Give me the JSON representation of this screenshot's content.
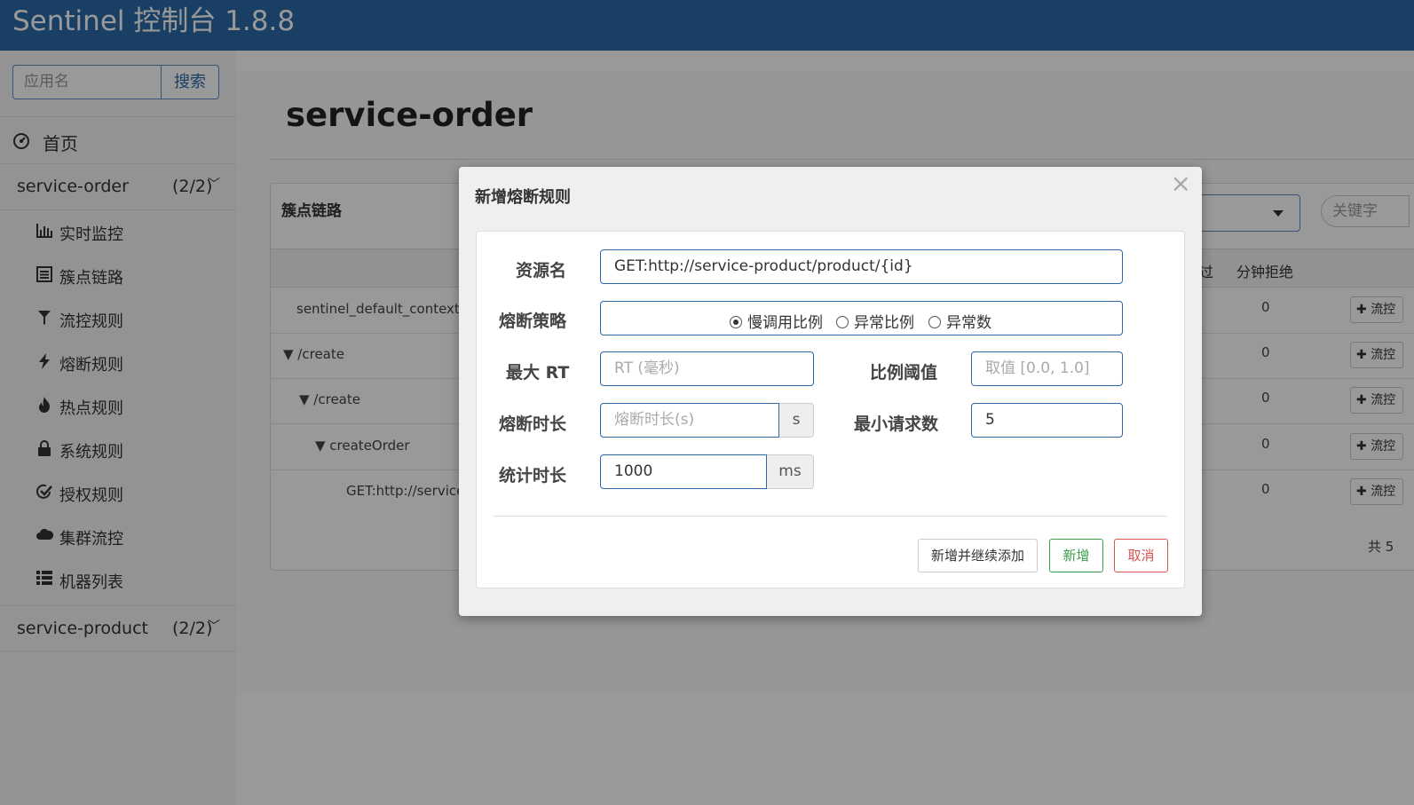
{
  "app": {
    "title": "Sentinel 控制台 1.8.8"
  },
  "sidebar": {
    "search_placeholder": "应用名",
    "search_button": "搜索",
    "home_label": "首页",
    "apps": [
      {
        "name": "service-order",
        "count": "(2/2)"
      },
      {
        "name": "service-product",
        "count": "(2/2)"
      }
    ],
    "menu": [
      {
        "label": "实时监控",
        "icon": "bar-chart-icon"
      },
      {
        "label": "簇点链路",
        "icon": "list-icon"
      },
      {
        "label": "流控规则",
        "icon": "filter-icon"
      },
      {
        "label": "熔断规则",
        "icon": "flash-icon"
      },
      {
        "label": "热点规则",
        "icon": "fire-icon"
      },
      {
        "label": "系统规则",
        "icon": "lock-icon"
      },
      {
        "label": "授权规则",
        "icon": "check-icon"
      },
      {
        "label": "集群流控",
        "icon": "cloud-icon"
      },
      {
        "label": "机器列表",
        "icon": "th-list-icon"
      }
    ]
  },
  "main": {
    "page_title": "service-order",
    "panel_title": "簇点链路",
    "keyword_placeholder": "关键字",
    "table_headers": {
      "pass_partial": "过",
      "reject": "分钟拒绝"
    },
    "rows": [
      {
        "resource": "sentinel_default_context",
        "reject": "0",
        "action": "流控"
      },
      {
        "resource": "▼ /create",
        "reject": "0",
        "action": "流控"
      },
      {
        "resource": "▼ /create",
        "reject": "0",
        "action": "流控"
      },
      {
        "resource": "▼ createOrder",
        "reject": "0",
        "action": "流控"
      },
      {
        "resource": "GET:http://service-p",
        "reject": "0",
        "action": "流控"
      }
    ],
    "pager_partial": "共 5"
  },
  "modal": {
    "title": "新增熔断规则",
    "close_glyph": "×",
    "fields": {
      "resource_label": "资源名",
      "resource_value": "GET:http://service-product/product/{id}",
      "strategy_label": "熔断策略",
      "strategy_options": [
        "慢调用比例",
        "异常比例",
        "异常数"
      ],
      "strategy_selected": "慢调用比例",
      "max_rt_label": "最大 RT",
      "max_rt_placeholder": "RT (毫秒)",
      "ratio_label": "比例阈值",
      "ratio_placeholder": "取值 [0.0, 1.0]",
      "duration_label": "熔断时长",
      "duration_placeholder": "熔断时长(s)",
      "duration_unit": "s",
      "min_request_label": "最小请求数",
      "min_request_value": "5",
      "stat_label": "统计时长",
      "stat_value": "1000",
      "stat_unit": "ms"
    },
    "buttons": {
      "add_continue": "新增并继续添加",
      "add": "新增",
      "cancel": "取消"
    }
  },
  "colors": {
    "header": "#2a6aa9",
    "success": "#3aa04a",
    "danger": "#d9534f"
  }
}
